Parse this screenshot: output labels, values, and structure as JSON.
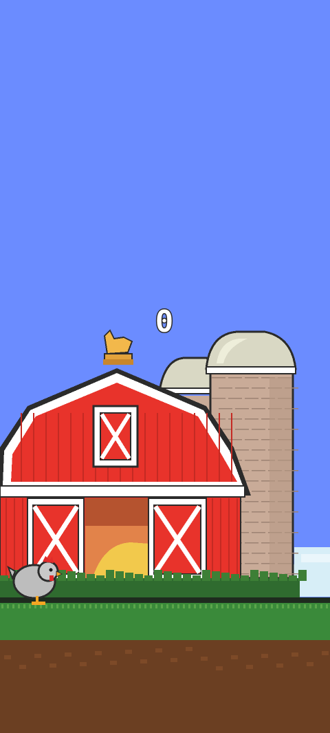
{
  "game": {
    "score": "0",
    "colors": {
      "sky": "#6b8cff",
      "barn_red": "#e8332b",
      "barn_trim": "#ffffff",
      "silo_brick": "#c9ab98",
      "silo_dome": "#d9d8c4",
      "grass": "#2f6b2f",
      "dirt": "#6b3f22",
      "hay": "#f2c94c"
    },
    "sprites": [
      "barn",
      "rooster-weathervane",
      "silo-front",
      "silo-back",
      "chicken",
      "grass-ground",
      "cloud"
    ]
  }
}
